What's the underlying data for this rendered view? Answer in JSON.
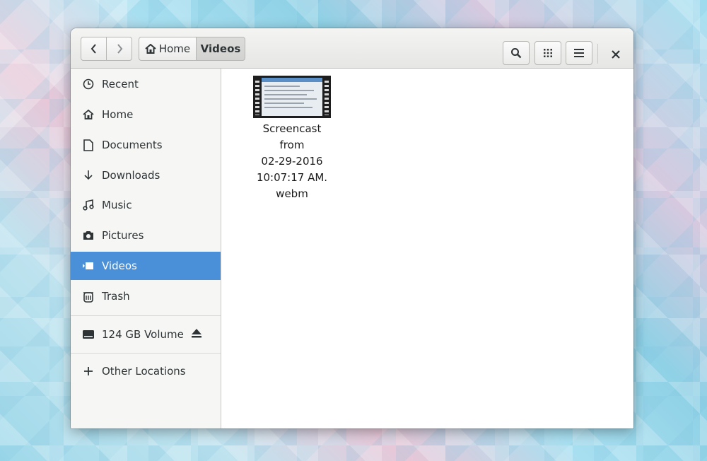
{
  "window": {
    "title": "Videos"
  },
  "toolbar": {
    "back_icon": "chevron-left-icon",
    "forward_icon": "chevron-right-icon",
    "search_icon": "search-icon",
    "view_icon": "grid-view-icon",
    "menu_icon": "hamburger-menu-icon",
    "close_icon": "close-icon"
  },
  "breadcrumb": {
    "home_label": "Home",
    "current_label": "Videos"
  },
  "sidebar": {
    "items": [
      {
        "label": "Recent",
        "icon": "clock-icon"
      },
      {
        "label": "Home",
        "icon": "home-icon"
      },
      {
        "label": "Documents",
        "icon": "document-icon"
      },
      {
        "label": "Downloads",
        "icon": "download-icon"
      },
      {
        "label": "Music",
        "icon": "music-icon"
      },
      {
        "label": "Pictures",
        "icon": "camera-icon"
      },
      {
        "label": "Videos",
        "icon": "video-icon",
        "active": true
      },
      {
        "label": "Trash",
        "icon": "trash-icon"
      }
    ],
    "volume": {
      "label": "124 GB Volume",
      "icon": "drive-icon",
      "action_icon": "eject-icon"
    },
    "other": {
      "label": "Other Locations",
      "icon": "plus-icon"
    }
  },
  "files": [
    {
      "line1": "Screencast from",
      "line2": "02-29-2016",
      "line3": "10:07:17 AM.",
      "line4": "webm"
    }
  ],
  "colors": {
    "accent": "#4a90d9"
  }
}
